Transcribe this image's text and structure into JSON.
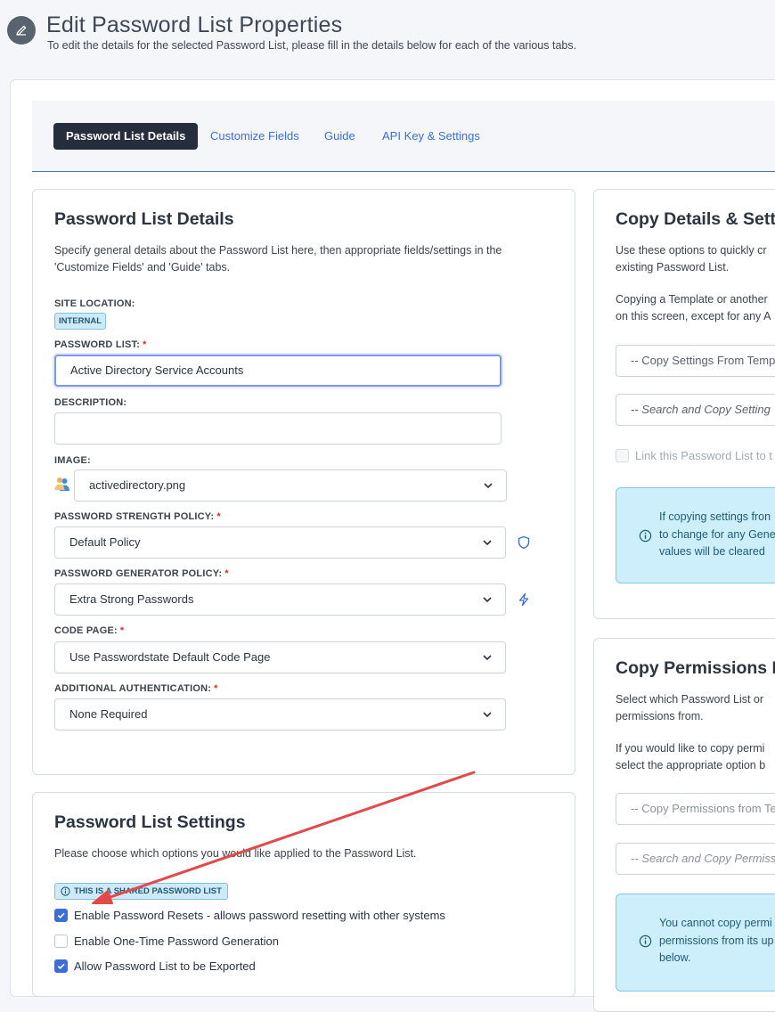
{
  "header": {
    "title": "Edit Password List Properties",
    "subtitle": "To edit the details for the selected Password List, please fill in the details below for each of the various tabs."
  },
  "tabs": [
    {
      "label": "Password List Details",
      "active": true
    },
    {
      "label": "Customize Fields",
      "active": false
    },
    {
      "label": "Guide",
      "active": false
    },
    {
      "label": "API Key & Settings",
      "active": false
    }
  ],
  "details": {
    "title": "Password List Details",
    "desc_line1": "Specify general details about the Password List here, then appropriate fields/settings in the",
    "desc_line2": "'Customize Fields' and 'Guide' tabs.",
    "site_location_label": "SITE LOCATION:",
    "site_location_value": "INTERNAL",
    "password_list_label": "PASSWORD LIST:",
    "password_list_value": "Active Directory Service Accounts",
    "description_label": "DESCRIPTION:",
    "description_value": "",
    "image_label": "IMAGE:",
    "image_value": "activedirectory.png",
    "strength_label": "PASSWORD STRENGTH POLICY:",
    "strength_value": "Default Policy",
    "generator_label": "PASSWORD GENERATOR POLICY:",
    "generator_value": "Extra Strong Passwords",
    "codepage_label": "CODE PAGE:",
    "codepage_value": "Use Passwordstate Default Code Page",
    "auth_label": "ADDITIONAL AUTHENTICATION:",
    "auth_value": "None Required",
    "required_mark": "*"
  },
  "settings": {
    "title": "Password List Settings",
    "desc": "Please choose which options you would like applied to the Password List.",
    "shared_badge": "THIS IS A SHARED PASSWORD LIST",
    "options": [
      {
        "label": "Enable Password Resets - allows password resetting with other systems",
        "checked": true
      },
      {
        "label": "Enable One-Time Password Generation",
        "checked": false
      },
      {
        "label": "Allow Password List to be Exported",
        "checked": true
      }
    ]
  },
  "copy_details": {
    "title": "Copy Details & Sett",
    "desc1_line1": "Use these options to quickly cr",
    "desc1_line2": "existing Password List.",
    "desc2_line1": "Copying a Template or another",
    "desc2_line2": "on this screen, except for any A",
    "select_template": "-- Copy Settings From Temp",
    "search_copy": "-- Search and Copy Setting",
    "link_label": "Link this Password List to t",
    "info_line1": "If copying settings fron",
    "info_line2": "to change for any Gene",
    "info_line3": "values will be cleared"
  },
  "copy_permissions": {
    "title": "Copy Permissions F",
    "desc1_line1": "Select which Password List or",
    "desc1_line2": "permissions from.",
    "desc2_line1": "If you would like to copy permi",
    "desc2_line2": "select the appropriate option b",
    "select_template": "-- Copy Permissions from Te",
    "search_copy": "-- Search and Copy Permiss",
    "info_line1": "You cannot copy permi",
    "info_line2": "permissions from its up",
    "info_line3": "below."
  },
  "colors": {
    "accent": "#3c6fd6",
    "active_tab_bg": "#262d3c",
    "info_bg": "#cdeefb",
    "annotation_arrow": "#e24a4a"
  }
}
